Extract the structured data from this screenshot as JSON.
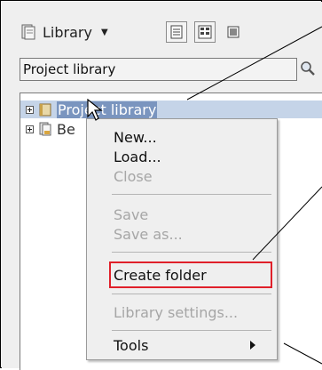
{
  "toolbar": {
    "library_label": "Library",
    "library_icon": "library-icon",
    "dropdown_icon": "chevron-down-icon",
    "view_buttons": [
      "list-view-icon",
      "tree-view-icon",
      "detail-view-icon"
    ]
  },
  "search": {
    "value": "Project library",
    "icon": "search-icon"
  },
  "tree": {
    "items": [
      {
        "label": "Project library",
        "icon": "project-library-icon",
        "selected": true
      },
      {
        "label": "Be",
        "icon": "library-icon",
        "selected": false
      }
    ]
  },
  "context_menu": {
    "items": [
      {
        "label": "New...",
        "enabled": true
      },
      {
        "label": "Load...",
        "enabled": true
      },
      {
        "label": "Close",
        "enabled": false
      },
      {
        "label": "Save",
        "enabled": false
      },
      {
        "label": "Save as...",
        "enabled": false
      },
      {
        "label": "Create folder",
        "enabled": true,
        "highlighted": true
      },
      {
        "label": "Library settings...",
        "enabled": false
      },
      {
        "label": "Tools",
        "enabled": true,
        "submenu": true
      }
    ]
  },
  "colors": {
    "selection_bg": "#c5d4e8",
    "selection_text_bg": "#7a95bf",
    "highlight_border": "#e0202a",
    "disabled_text": "#a6a6a6"
  }
}
